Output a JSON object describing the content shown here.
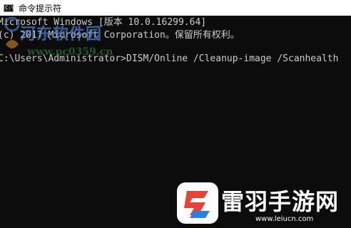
{
  "window": {
    "icon_text": "C:\\",
    "title": "命令提示符"
  },
  "console": {
    "lines": [
      "Microsoft Windows [版本 10.0.16299.64]",
      "(c) 2017 Microsoft Corporation。保留所有权利。",
      "",
      "C:\\Users\\Administrator>DISM/Online /Cleanup-image /Scanhealth"
    ]
  },
  "watermarks": {
    "site_name": "河东软件园",
    "site_url": "www.pc0359.cn",
    "brand_name": "雷羽手游网",
    "brand_url": "www.leiucn.com"
  },
  "colors": {
    "console_bg": "#0c0c0c",
    "console_text": "#cccccc",
    "titlebar_bg": "#ffffff",
    "brand_red": "#e8413a",
    "brand_blue": "#2a7fe0"
  },
  "icons": {
    "app": "cmd-icon",
    "brand": "leiyu-logo-icon",
    "watermark": "hedong-logo-icon"
  }
}
